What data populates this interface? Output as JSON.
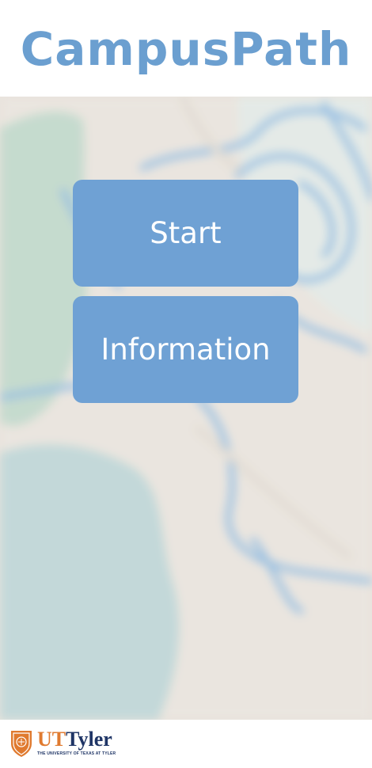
{
  "header": {
    "title": "CampusPath"
  },
  "menu": {
    "start_label": "Start",
    "info_label": "Information"
  },
  "footer": {
    "logo_ut": "UT",
    "logo_tyler": "Tyler",
    "logo_subtitle": "THE UNIVERSITY OF TEXAS AT TYLER"
  },
  "colors": {
    "accent": "#6fa1d4",
    "title": "#6b9fd0",
    "logo_orange": "#e07a2f",
    "logo_navy": "#1f3566"
  }
}
